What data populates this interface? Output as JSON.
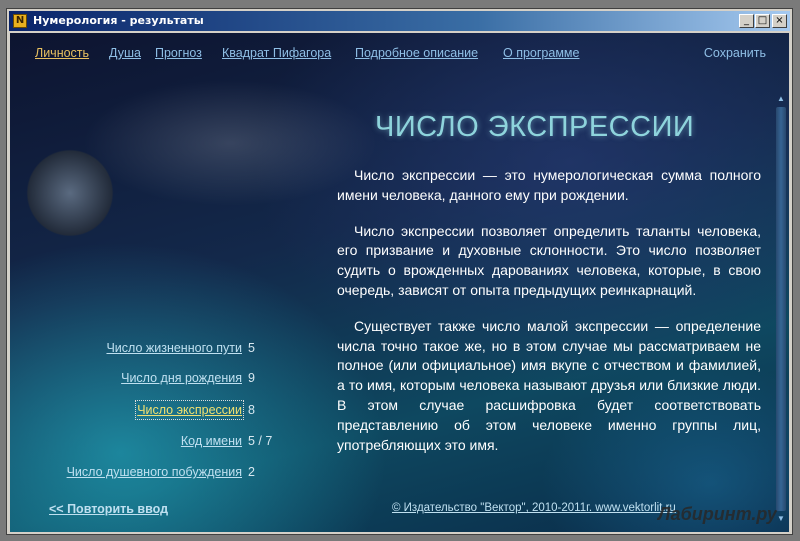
{
  "window": {
    "title": "Нумерология - результаты",
    "minimize": "_",
    "maximize": "□",
    "close": "×"
  },
  "nav": {
    "items": [
      "Личность",
      "Душа",
      "Прогноз",
      "Квадрат Пифагора",
      "Подробное описание",
      "О программе"
    ],
    "active": "Личность",
    "save": "Сохранить"
  },
  "main": {
    "heading": "ЧИСЛО ЭКСПРЕССИИ",
    "paragraphs": [
      "Число экспрессии — это нумерологическая сумма полного имени человека, данного ему при рождении.",
      "Число экспрессии позволяет определить таланты человека, его призвание и духовные склонности. Это число позволяет судить о врожденных дарованиях человека, которые, в свою очередь, зависят от опыта предыдущих реинкарнаций.",
      "Существует также число малой экспрессии — определение числа точно такое же, но в этом случае мы рассматриваем не полное (или официальное) имя вкупе с отчеством и фамилией, а то имя, которым человека называют друзья или близкие люди. В этом случае расшифровка будет соответствовать представлению об этом человеке именно группы лиц, употребляющих это имя."
    ]
  },
  "sidebar": {
    "items": [
      {
        "label": "Число жизненного пути",
        "value": "5"
      },
      {
        "label": "Число дня рождения",
        "value": "9"
      },
      {
        "label": "Число экспрессии",
        "value": "8"
      },
      {
        "label": "Код имени",
        "value": "5 / 7"
      },
      {
        "label": "Число душевного побуждения",
        "value": "2"
      }
    ],
    "active_index": 2
  },
  "footer": {
    "repeat": "<< Повторить ввод",
    "copyright": "© Издательство \"Вектор\", 2010-2011г. www.vektorlit.ru"
  },
  "watermark": "Лабиринт.ру",
  "scrollbar": {
    "up": "▲",
    "down": "▼"
  }
}
